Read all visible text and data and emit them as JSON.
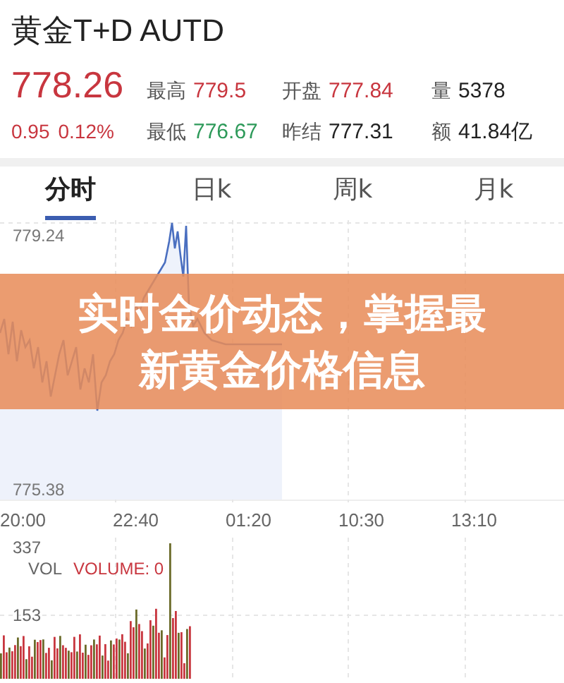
{
  "header": {
    "title": "黄金T+D AUTD",
    "price": "778.26",
    "change": "0.95",
    "change_pct": "0.12%",
    "stats": [
      {
        "label": "最高",
        "value": "779.5",
        "color": "#c8363f"
      },
      {
        "label": "开盘",
        "value": "777.84",
        "color": "#c8363f"
      },
      {
        "label": "量",
        "value": "5378",
        "color": "#222222"
      },
      {
        "label": "最低",
        "value": "776.67",
        "color": "#2e9a5a"
      },
      {
        "label": "昨结",
        "value": "777.31",
        "color": "#222222"
      },
      {
        "label": "额",
        "value": "41.84亿",
        "color": "#222222"
      }
    ]
  },
  "tabs": [
    {
      "label": "分时",
      "selected": true
    },
    {
      "label": "日k",
      "selected": false
    },
    {
      "label": "周k",
      "selected": false
    },
    {
      "label": "月k",
      "selected": false
    }
  ],
  "price_chart": {
    "high_label": "779.24",
    "low_label": "775.38"
  },
  "time_axis": [
    "20:00",
    "22:40",
    "01:20",
    "10:30",
    "13:10"
  ],
  "volume_chart": {
    "max_label": "337",
    "mid_label": "153",
    "indicator": "VOL",
    "reading": "VOLUME: 0"
  },
  "banner": {
    "text": "实时金价动态，掌握最新黄金价格信息"
  }
}
